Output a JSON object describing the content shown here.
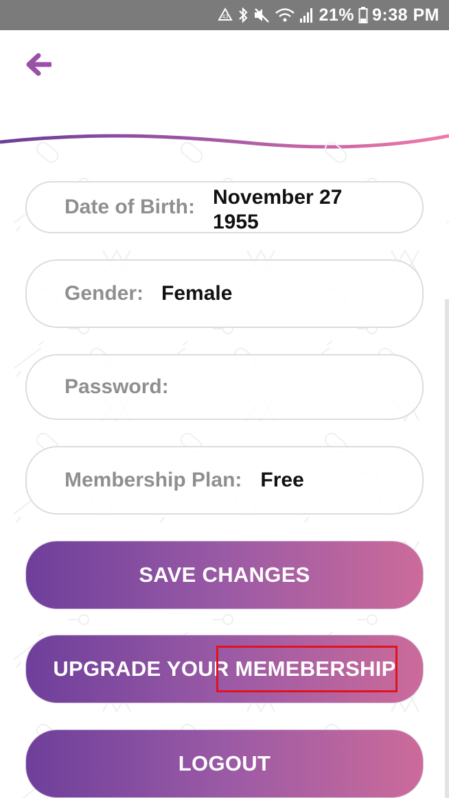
{
  "status_bar": {
    "battery_percent": "21%",
    "time": "9:38 PM",
    "icons": [
      "sync-icon",
      "bluetooth-icon",
      "mute-icon",
      "wifi-icon",
      "signal-icon",
      "battery-icon"
    ]
  },
  "header": {
    "back_icon": "arrow-left-icon"
  },
  "form": {
    "dob_label": "Date of Birth:",
    "dob_value": "November 27 1955",
    "gender_label": "Gender:",
    "gender_value": "Female",
    "password_label": "Password:",
    "password_value": "",
    "plan_label": "Membership Plan:",
    "plan_value": "Free"
  },
  "buttons": {
    "save": "SAVE CHANGES",
    "upgrade": "UPGRADE YOUR MEMEBERSHIP",
    "logout": "LOGOUT"
  },
  "colors": {
    "accent_purple": "#9b4fa8",
    "gradient_start": "#6e3f9b",
    "gradient_end": "#cc6b9a",
    "highlight": "#e0121e"
  }
}
